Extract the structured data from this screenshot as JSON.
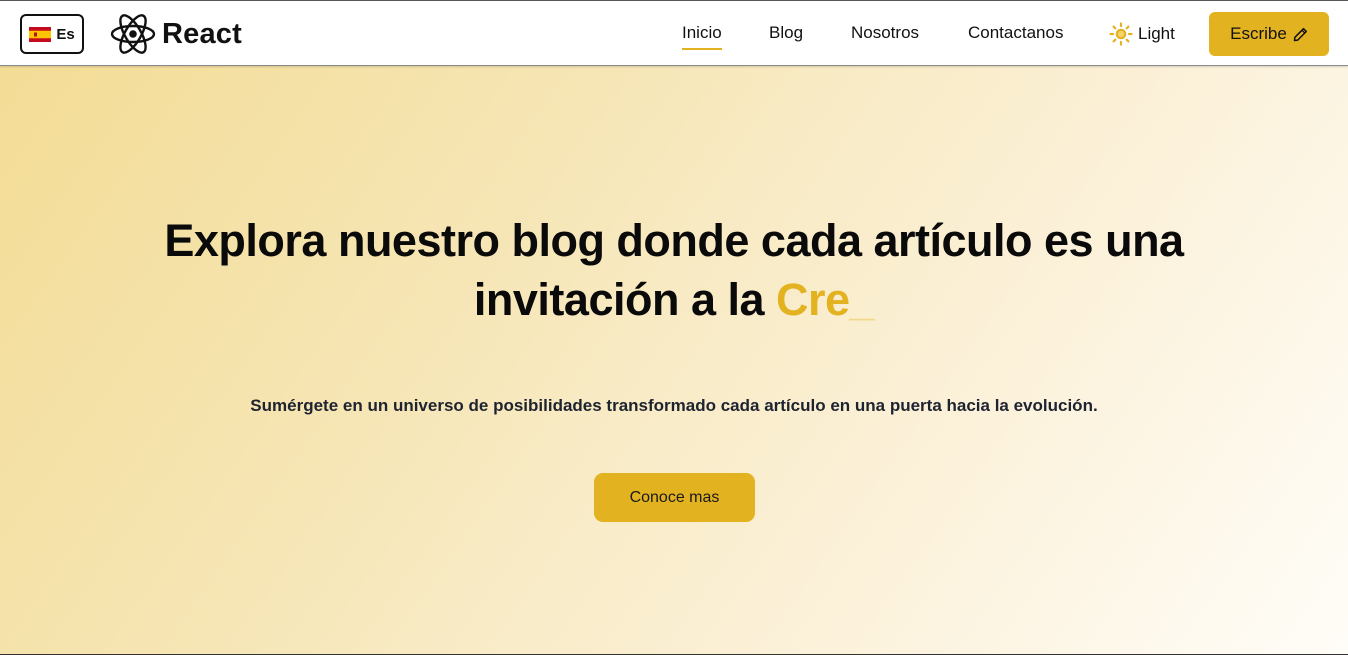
{
  "language": {
    "label": "Es",
    "flag_icon": "spain-flag-icon"
  },
  "brand": {
    "name": "React",
    "logo_icon": "react-atom-icon"
  },
  "nav": {
    "items": [
      {
        "label": "Inicio",
        "active": true
      },
      {
        "label": "Blog",
        "active": false
      },
      {
        "label": "Nosotros",
        "active": false
      },
      {
        "label": "Contactanos",
        "active": false
      }
    ]
  },
  "theme": {
    "label": "Light",
    "icon": "sun-icon"
  },
  "write_button": {
    "label": "Escribe",
    "icon": "pencil-icon"
  },
  "hero": {
    "title_line1": "Explora nuestro blog donde cada artículo es una",
    "title_line2_prefix": "invitación a la ",
    "typed_word": "Cre",
    "cursor": "_",
    "subtitle": "Sumérgete en un universo de posibilidades transformado cada artículo en una puerta hacia la evolución.",
    "cta_label": "Conoce mas"
  },
  "colors": {
    "accent": "#e3b220",
    "hero_gradient_start": "#f3dc95",
    "hero_gradient_end": "#fffdf8",
    "text_dark": "#0a0a0a"
  }
}
